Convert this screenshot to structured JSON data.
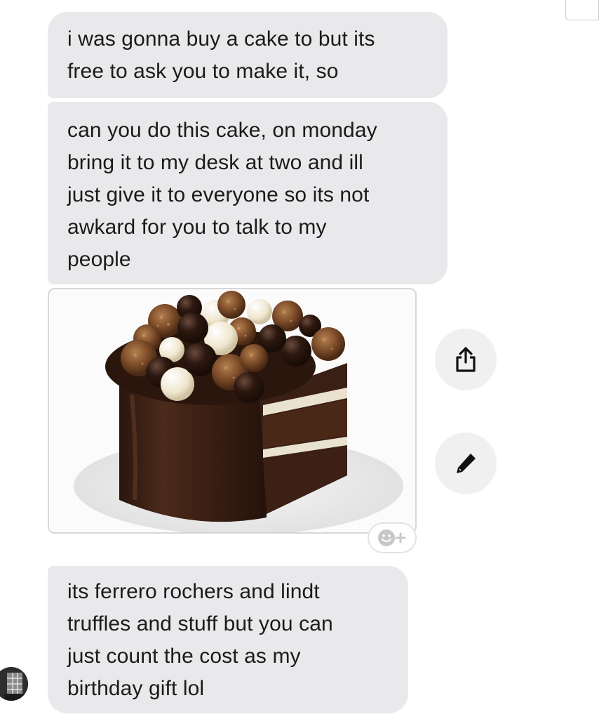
{
  "conversation": {
    "messages": [
      {
        "lines": [
          "i was gonna buy a cake to but its",
          "free to ask you to make it, so"
        ]
      },
      {
        "lines": [
          "can you do this cake, on monday",
          "bring it to my desk at two and ill",
          "just give it to everyone so its not",
          "awkard for you to talk to my",
          "people"
        ]
      },
      {
        "image": "chocolate-cake-with-ferrero-rochers-and-lindt-truffles"
      },
      {
        "lines": [
          "its ferrero rochers and lindt",
          "truffles and stuff but you can",
          "just count the cost as my",
          "birthday gift lol"
        ]
      }
    ],
    "actions": {
      "share_icon": "share-icon",
      "edit_icon": "pencil-icon",
      "react_icon": "add-reaction-icon"
    },
    "colors": {
      "bubble": "#e9e9eb",
      "text": "#1b1b1b",
      "action_bg": "#f0f0f0"
    }
  }
}
